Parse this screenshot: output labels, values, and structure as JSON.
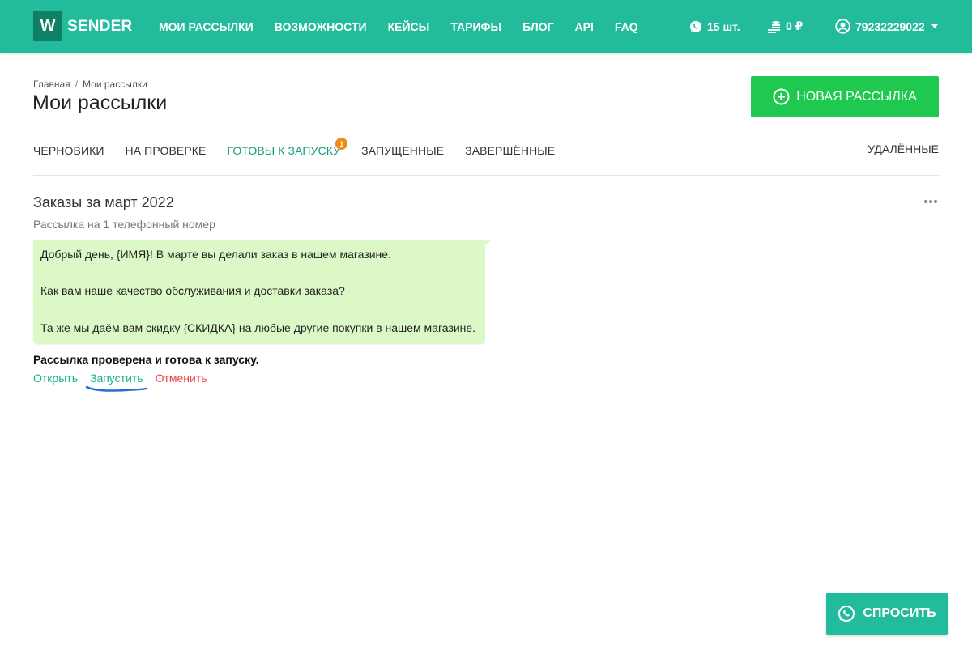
{
  "colors": {
    "header": "#22bb9c",
    "accent": "#159e80",
    "primary_button": "#1fc950",
    "badge": "#f28a14",
    "danger": "#e5484d",
    "bubble": "#dbf8c6"
  },
  "header": {
    "logo_letter": "W",
    "logo_text": "SENDER",
    "nav": [
      "МОИ РАССЫЛКИ",
      "ВОЗМОЖНОСТИ",
      "КЕЙСЫ",
      "ТАРИФЫ",
      "БЛОГ",
      "API",
      "FAQ"
    ],
    "messages": {
      "icon": "whatsapp-icon",
      "count": "15 шт."
    },
    "balance": {
      "icon": "coins-icon",
      "value": "0 ₽"
    },
    "user": {
      "icon": "user-avatar-icon",
      "phone": "79232229022"
    }
  },
  "breadcrumb": {
    "home": "Главная",
    "current": "Мои рассылки",
    "separator": "/"
  },
  "page_title": "Мои рассылки",
  "new_button": {
    "label": "НОВАЯ РАССЫЛКА",
    "icon": "plus-circle-icon"
  },
  "tabs": [
    {
      "label": "ЧЕРНОВИКИ"
    },
    {
      "label": "НА ПРОВЕРКЕ"
    },
    {
      "label": "ГОТОВЫ К ЗАПУСКУ",
      "badge": "1",
      "active": true
    },
    {
      "label": "ЗАПУЩЕННЫЕ"
    },
    {
      "label": "ЗАВЕРШЁННЫЕ"
    }
  ],
  "tab_deleted": "УДАЛЁННЫЕ",
  "campaign": {
    "title": "Заказы за март 2022",
    "subtitle": "Рассылка на 1 телефонный номер",
    "message_lines": [
      "Добрый день, {ИМЯ}! В марте вы делали заказ в нашем магазине.",
      "Как вам наше качество обслуживания и доставки заказа?",
      "Та же мы даём вам скидку {СКИДКА} на любые другие покупки в нашем магазине."
    ],
    "status": "Рассылка проверена и готова к запуску.",
    "actions": {
      "open": "Открыть",
      "launch": "Запустить",
      "cancel": "Отменить"
    }
  },
  "ask_button": {
    "label": "СПРОСИТЬ",
    "icon": "whatsapp-icon"
  }
}
